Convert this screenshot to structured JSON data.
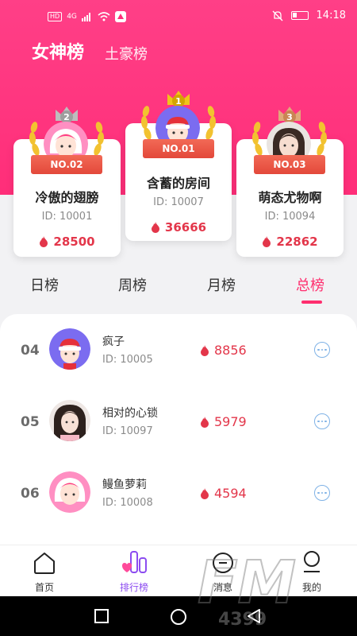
{
  "status_bar": {
    "left_badges": [
      "HD",
      "4G"
    ],
    "time": "14:18"
  },
  "header_tabs": {
    "active": "女神榜",
    "other": "土豪榜"
  },
  "podium": [
    {
      "rank_number": "2",
      "ribbon": "NO.02",
      "name": "冷傲的翅膀",
      "id": "ID: 10001",
      "score": "28500"
    },
    {
      "rank_number": "1",
      "ribbon": "NO.01",
      "name": "含蓄的房间",
      "id": "ID: 10007",
      "score": "36666"
    },
    {
      "rank_number": "3",
      "ribbon": "NO.03",
      "name": "萌态尤物啊",
      "id": "ID: 10094",
      "score": "22862"
    }
  ],
  "periods": {
    "day": "日榜",
    "week": "周榜",
    "month": "月榜",
    "total": "总榜",
    "active": "total"
  },
  "list": [
    {
      "rank": "04",
      "name": "疯子",
      "id": "ID: 10005",
      "score": "8856"
    },
    {
      "rank": "05",
      "name": "相对的心锁",
      "id": "ID: 10097",
      "score": "5979"
    },
    {
      "rank": "06",
      "name": "鳗鱼萝莉",
      "id": "ID: 10008",
      "score": "4594"
    }
  ],
  "bottom_nav": {
    "home": "首页",
    "ranking": "排行榜",
    "messages": "消息",
    "mine": "我的",
    "active": "ranking"
  },
  "watermark": {
    "line1": "FM",
    "line2": "4399"
  },
  "colors": {
    "brand_pink": "#ff2e79",
    "score_red": "#e3364a",
    "nav_active": "#8c4cf0",
    "gold": "#f0c419",
    "silver": "#bdbdbd",
    "bronze": "#e0a97a"
  }
}
